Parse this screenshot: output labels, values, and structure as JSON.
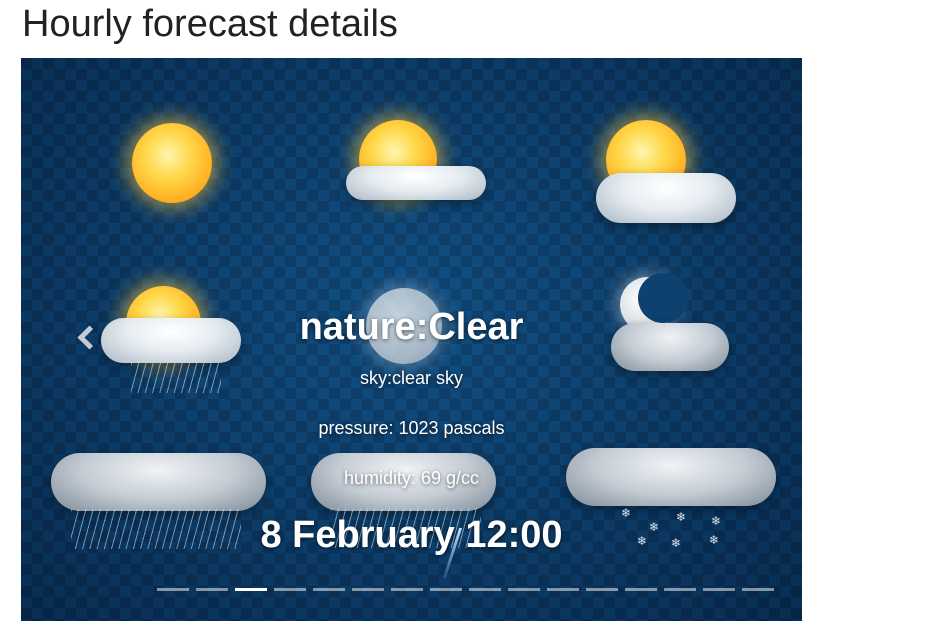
{
  "page": {
    "title": "Hourly forecast details"
  },
  "carousel": {
    "prev_icon": "chevron-left-icon",
    "active_slide": 3,
    "slide_count": 16,
    "slide": {
      "nature": "nature:Clear",
      "sky": "sky:clear sky",
      "pressure": "pressure: 1023 pascals",
      "humidity": "humidity: 69 g/cc",
      "datetime": "8 February 12:00"
    },
    "background_icons": [
      "sun-icon",
      "sun-behind-cloud-icon",
      "sun-behind-large-cloud-icon",
      "sun-cloud-rain-icon",
      "moon-icon",
      "crescent-moon-cloud-icon",
      "rain-cloud-icon",
      "thunderstorm-cloud-icon",
      "snow-cloud-icon"
    ]
  },
  "colors": {
    "background": "#0b3a63",
    "checker": "#0e4a7c",
    "caption": "#ffffff",
    "title": "#222222"
  }
}
